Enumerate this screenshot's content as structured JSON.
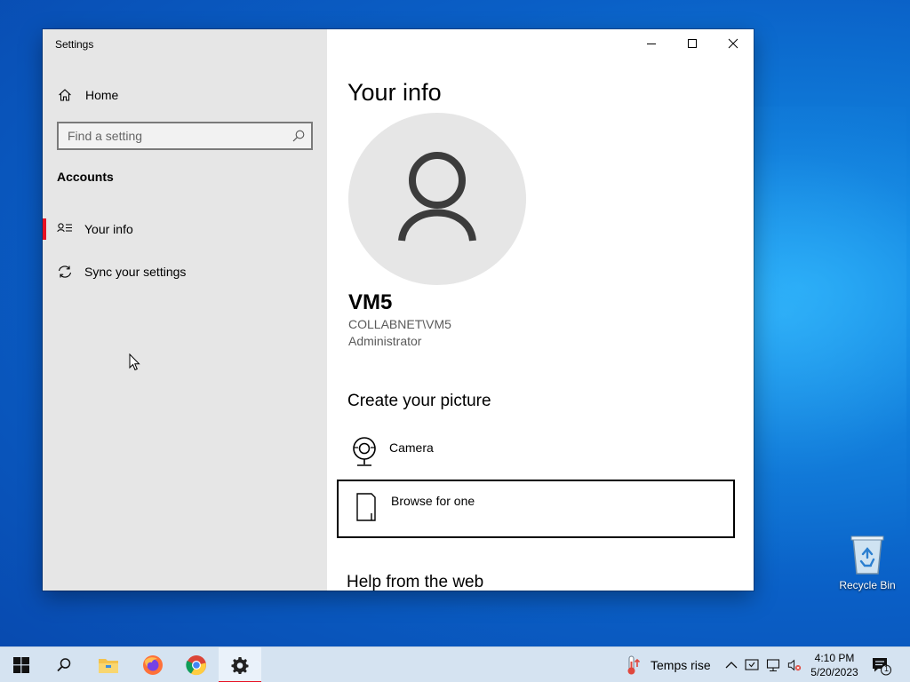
{
  "window": {
    "title": "Settings"
  },
  "sidebar": {
    "home_label": "Home",
    "search_placeholder": "Find a setting",
    "section_label": "Accounts",
    "items": [
      {
        "label": "Your info",
        "selected": true,
        "icon": "person-list-icon"
      },
      {
        "label": "Sync your settings",
        "selected": false,
        "icon": "sync-icon"
      }
    ]
  },
  "main": {
    "title": "Your info",
    "user": {
      "name": "VM5",
      "domain": "COLLABNET\\VM5",
      "role": "Administrator"
    },
    "create_picture": {
      "title": "Create your picture",
      "options": [
        {
          "label": "Camera",
          "icon": "camera-icon"
        },
        {
          "label": "Browse for one",
          "icon": "file-icon"
        }
      ]
    },
    "help_title": "Help from the web"
  },
  "desktop": {
    "recycle_bin_label": "Recycle Bin"
  },
  "taskbar": {
    "weather_text": "Temps rise",
    "time": "4:10 PM",
    "date": "5/20/2023",
    "notification_count": "1"
  },
  "colors": {
    "accent": "#e81123",
    "sidebar_bg": "#e6e6e6",
    "taskbar_bg": "#d5e3f1"
  }
}
